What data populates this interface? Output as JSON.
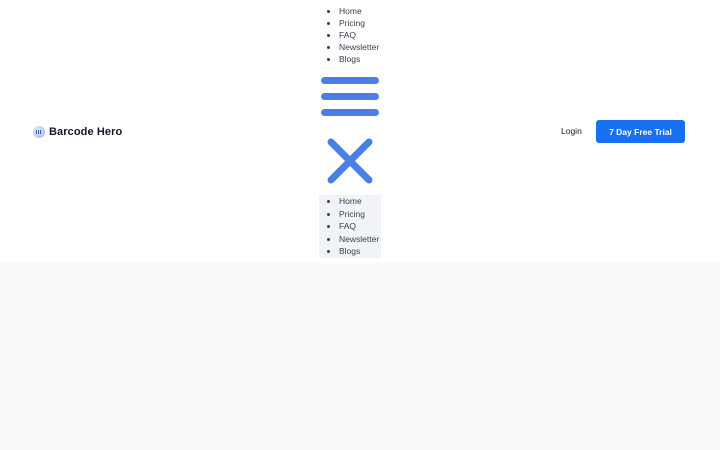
{
  "brand": {
    "name": "Barcode Hero",
    "logo_icon": "barcode-logo-icon"
  },
  "nav": {
    "top_items": [
      "Home",
      "Pricing",
      "FAQ",
      "Newsletter",
      "Blogs"
    ],
    "bottom_items": [
      "Home",
      "Pricing",
      "FAQ",
      "Newsletter",
      "Blogs"
    ]
  },
  "icons": {
    "menu": "hamburger-menu-icon",
    "close": "close-icon",
    "accent_color": "#4a7fe5"
  },
  "auth": {
    "login_label": "Login",
    "trial_label": "7 Day Free Trial",
    "trial_color": "#1670f0"
  }
}
